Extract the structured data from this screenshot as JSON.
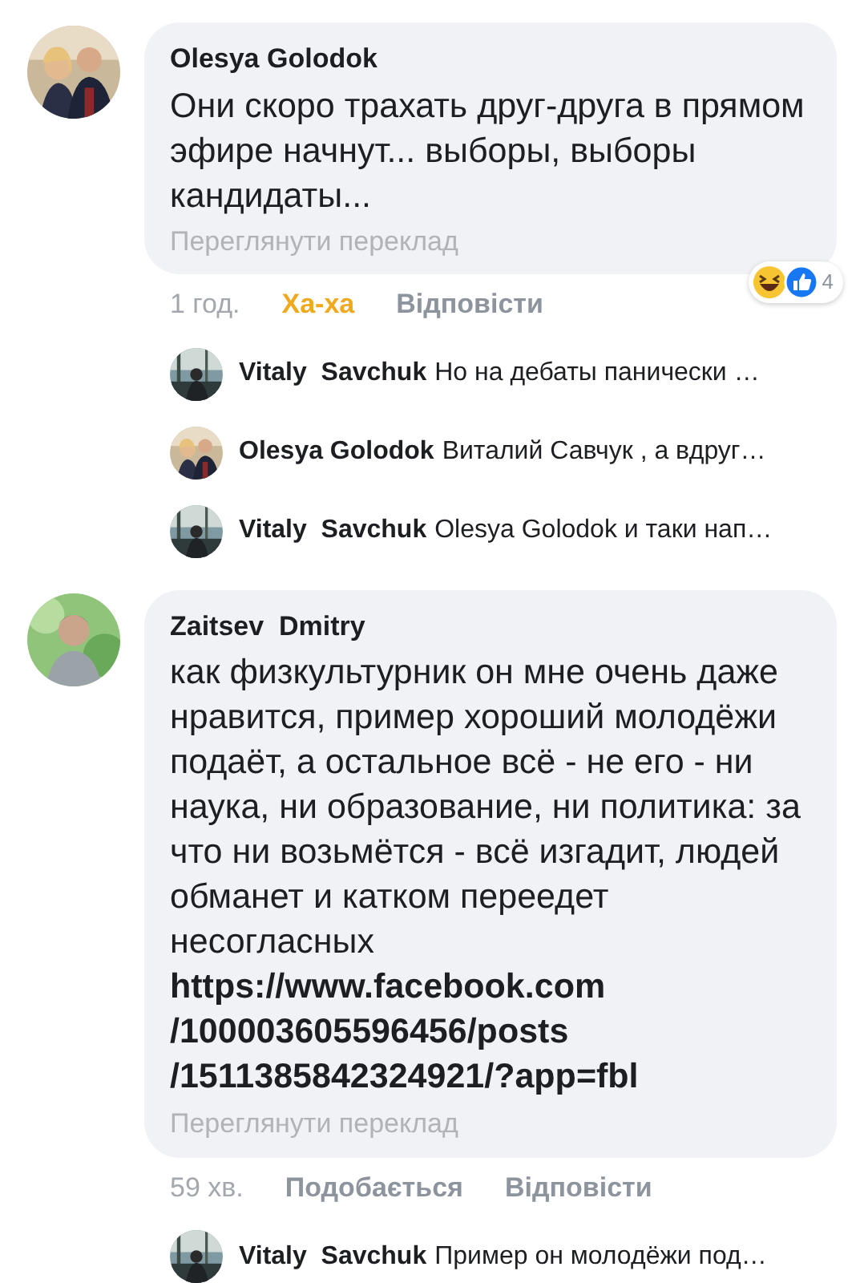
{
  "comments": [
    {
      "author": "Olesya Golodok",
      "avatar": {
        "kind": "picture"
      },
      "text": "Они скоро трахать друг-друга в прямом эфире начнут... выборы, выборы кандидаты...",
      "translate": "Переглянути переклад",
      "time": "1 год.",
      "like": {
        "label": "Ха-ха",
        "selected": true
      },
      "reply": "Відповісти",
      "reactions": {
        "count": "4"
      },
      "replies": [
        {
          "author": "Vitaly  Savchuk",
          "snippet": "Но на дебаты панически …"
        },
        {
          "author": "Olesya Golodok",
          "snippet": "Виталий Савчук , а вдруг…"
        },
        {
          "author": "Vitaly  Savchuk",
          "snippet": "Olesya Golodok и таки нап…"
        }
      ]
    },
    {
      "author": "Zaitsev  Dmitry",
      "avatar": {
        "kind": "picture"
      },
      "text": "как физкультурник он мне очень даже нравится, пример хороший молодёжи подаёт, а остальное всё - не его - ни наука, ни образование, ни политика: за что ни возьмётся - всё изгадит, людей обманет и катком переедет несогласных",
      "link": "https://www.facebook.com/100003605596456/posts/1511385842324921/?app=fbl",
      "translate": "Переглянути переклад",
      "time": "59 хв.",
      "like": {
        "label": "Подобається",
        "selected": false
      },
      "reply": "Відповісти",
      "replies": [
        {
          "author": "Vitaly  Savchuk",
          "snippet": "Пример он молодёжи под…"
        }
      ]
    }
  ]
}
